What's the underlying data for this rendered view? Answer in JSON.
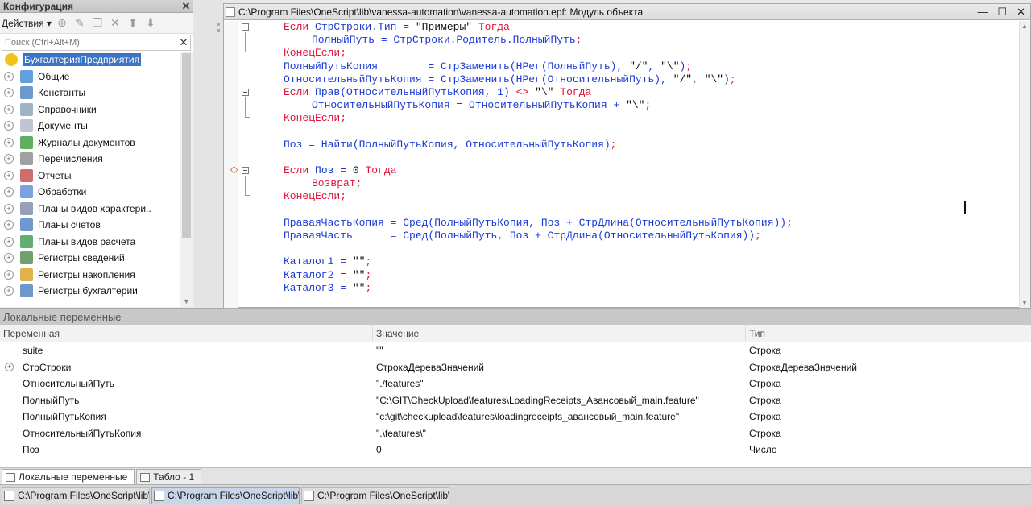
{
  "config_panel": {
    "title": "Конфигурация",
    "actions_label": "Действия ▾",
    "search_placeholder": "Поиск (Ctrl+Alt+M)",
    "tree": [
      {
        "label": "БухгалтерияПредприятия",
        "icon": "root-config-icon"
      },
      {
        "label": "Общие",
        "icon": "common-icon"
      },
      {
        "label": "Константы",
        "icon": "constants-icon"
      },
      {
        "label": "Справочники",
        "icon": "catalogs-icon"
      },
      {
        "label": "Документы",
        "icon": "documents-icon"
      },
      {
        "label": "Журналы документов",
        "icon": "journals-icon"
      },
      {
        "label": "Перечисления",
        "icon": "enums-icon"
      },
      {
        "label": "Отчеты",
        "icon": "reports-icon"
      },
      {
        "label": "Обработки",
        "icon": "processors-icon"
      },
      {
        "label": "Планы видов характери..",
        "icon": "char-plans-icon"
      },
      {
        "label": "Планы счетов",
        "icon": "accounts-plans-icon"
      },
      {
        "label": "Планы видов расчета",
        "icon": "calc-plans-icon"
      },
      {
        "label": "Регистры сведений",
        "icon": "info-registers-icon"
      },
      {
        "label": "Регистры накопления",
        "icon": "accum-registers-icon"
      },
      {
        "label": "Регистры бухгалтерии",
        "icon": "account-registers-icon"
      }
    ]
  },
  "code_window": {
    "title": "C:\\Program Files\\OneScript\\lib\\vanessa-automation\\vanessa-automation.epf: Модуль объекта",
    "lines": [
      {
        "indent": 0,
        "tokens": [
          [
            "kw",
            "Если "
          ],
          [
            "dflt",
            "СтрСтроки.Тип = "
          ],
          [
            "st",
            "\"Примеры\""
          ],
          [
            "kw",
            " Тогда"
          ]
        ]
      },
      {
        "indent": 1,
        "tokens": [
          [
            "dflt",
            "ПолныйПуть = СтрСтроки.Родитель.ПолныйПуть"
          ],
          [
            "op",
            ";"
          ]
        ]
      },
      {
        "indent": 0,
        "tokens": [
          [
            "kw",
            "КонецЕсли;"
          ]
        ]
      },
      {
        "indent": 0,
        "tokens": [
          [
            "dflt",
            "ПолныйПутьКопия        = СтрЗаменить(НРег(ПолныйПуть), "
          ],
          [
            "st",
            "\"/\""
          ],
          [
            "dflt",
            ", "
          ],
          [
            "st",
            "\"\\\""
          ],
          [
            "dflt",
            ")"
          ],
          [
            "op",
            ";"
          ]
        ]
      },
      {
        "indent": 0,
        "tokens": [
          [
            "dflt",
            "ОтносительныйПутьКопия = СтрЗаменить(НРег(ОтносительныйПуть), "
          ],
          [
            "st",
            "\"/\""
          ],
          [
            "dflt",
            ", "
          ],
          [
            "st",
            "\"\\\""
          ],
          [
            "dflt",
            ")"
          ],
          [
            "op",
            ";"
          ]
        ]
      },
      {
        "indent": 0,
        "tokens": [
          [
            "kw",
            "Если "
          ],
          [
            "dflt",
            "Прав(ОтносительныйПутьКопия, 1) "
          ],
          [
            "op",
            "<>"
          ],
          [
            "st",
            " \"\\\""
          ],
          [
            "kw",
            " Тогда"
          ]
        ]
      },
      {
        "indent": 1,
        "tokens": [
          [
            "dflt",
            "ОтносительныйПутьКопия = ОтносительныйПутьКопия + "
          ],
          [
            "st",
            "\"\\\""
          ],
          [
            "op",
            ";"
          ]
        ]
      },
      {
        "indent": 0,
        "tokens": [
          [
            "kw",
            "КонецЕсли;"
          ]
        ]
      },
      {
        "indent": 0,
        "tokens": []
      },
      {
        "indent": 0,
        "tokens": [
          [
            "dflt",
            "Поз = Найти(ПолныйПутьКопия, ОтносительныйПутьКопия)"
          ],
          [
            "op",
            ";"
          ]
        ]
      },
      {
        "indent": 0,
        "tokens": []
      },
      {
        "indent": 0,
        "tokens": [
          [
            "kw",
            "Если "
          ],
          [
            "dflt",
            "Поз = "
          ],
          [
            "st",
            "0"
          ],
          [
            "kw",
            " Тогда"
          ]
        ]
      },
      {
        "indent": 1,
        "tokens": [
          [
            "kw",
            "Возврат;"
          ]
        ]
      },
      {
        "indent": 0,
        "tokens": [
          [
            "kw",
            "КонецЕсли;"
          ]
        ]
      },
      {
        "indent": 0,
        "tokens": []
      },
      {
        "indent": 0,
        "tokens": [
          [
            "dflt",
            "ПраваяЧастьКопия = Сред(ПолныйПутьКопия, Поз + СтрДлина(ОтносительныйПутьКопия))"
          ],
          [
            "op",
            ";"
          ]
        ]
      },
      {
        "indent": 0,
        "tokens": [
          [
            "dflt",
            "ПраваяЧасть      = Сред(ПолныйПуть, Поз + СтрДлина(ОтносительныйПутьКопия))"
          ],
          [
            "op",
            ";"
          ]
        ]
      },
      {
        "indent": 0,
        "tokens": []
      },
      {
        "indent": 0,
        "tokens": [
          [
            "dflt",
            "Каталог1 = "
          ],
          [
            "st",
            "\"\""
          ],
          [
            "op",
            ";"
          ]
        ]
      },
      {
        "indent": 0,
        "tokens": [
          [
            "dflt",
            "Каталог2 = "
          ],
          [
            "st",
            "\"\""
          ],
          [
            "op",
            ";"
          ]
        ]
      },
      {
        "indent": 0,
        "tokens": [
          [
            "dflt",
            "Каталог3 = "
          ],
          [
            "st",
            "\"\""
          ],
          [
            "op",
            ";"
          ]
        ]
      }
    ]
  },
  "locals": {
    "title": "Локальные переменные",
    "headers": [
      "Переменная",
      "Значение",
      "Тип"
    ],
    "rows": [
      {
        "name": "suite",
        "value": "\"\"",
        "type": "Строка",
        "expandable": false
      },
      {
        "name": "СтрСтроки",
        "value": "СтрокаДереваЗначений",
        "type": "СтрокаДереваЗначений",
        "expandable": true
      },
      {
        "name": "ОтносительныйПуть",
        "value": "\"./features\"",
        "type": "Строка",
        "expandable": false
      },
      {
        "name": "ПолныйПуть",
        "value": "\"C:\\GIT\\CheckUpload\\features\\LoadingReceipts_Авансовый_main.feature\"",
        "type": "Строка",
        "expandable": false
      },
      {
        "name": "ПолныйПутьКопия",
        "value": "\"c:\\git\\checkupload\\features\\loadingreceipts_авансовый_main.feature\"",
        "type": "Строка",
        "expandable": false
      },
      {
        "name": "ОтносительныйПутьКопия",
        "value": "\".\\features\\\"",
        "type": "Строка",
        "expandable": false
      },
      {
        "name": "Поз",
        "value": "0",
        "type": "Число",
        "expandable": false
      }
    ]
  },
  "tabs": [
    {
      "label": "Локальные переменные",
      "active": true
    },
    {
      "label": "Табло - 1",
      "active": false
    }
  ],
  "taskbar": [
    {
      "label": "C:\\Program Files\\OneScript\\lib\\..",
      "active": false
    },
    {
      "label": "C:\\Program Files\\OneScript\\lib\\..",
      "active": true
    },
    {
      "label": "C:\\Program Files\\OneScript\\lib\\..",
      "active": false
    }
  ]
}
